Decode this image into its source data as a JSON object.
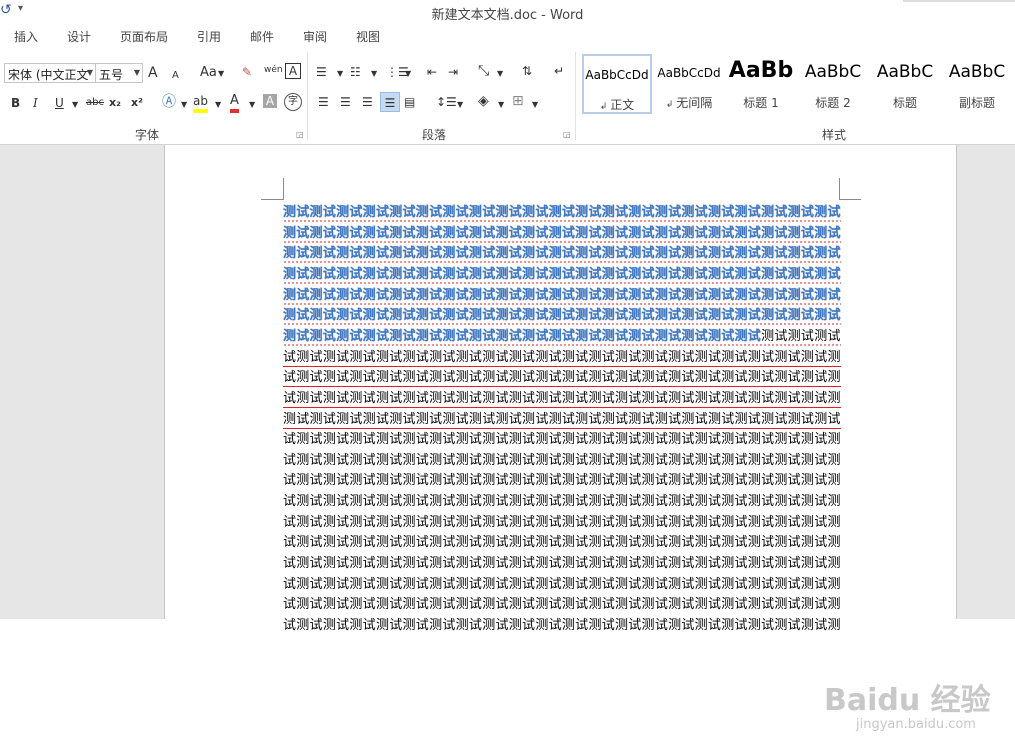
{
  "window": {
    "title": "新建文本文档.doc - Word"
  },
  "tabs": [
    "插入",
    "设计",
    "页面布局",
    "引用",
    "邮件",
    "审阅",
    "视图"
  ],
  "font_group": {
    "font_name": "宋体 (中文正文",
    "font_size": "五号",
    "grow_label": "A",
    "shrink_label": "A",
    "case_label": "Aa",
    "pinyin_label": "wén",
    "border_char_label": "A",
    "bold": "B",
    "italic": "I",
    "underline": "U",
    "strike": "abc",
    "subscript": "x₂",
    "superscript": "x²",
    "label": "字体"
  },
  "para_group": {
    "label": "段落"
  },
  "styles_group": {
    "label": "样式",
    "items": [
      {
        "sample": "AaBbCcDd",
        "name": "正文"
      },
      {
        "sample": "AaBbCcDd",
        "name": "无间隔"
      },
      {
        "sample": "AaBb",
        "name": "标题 1"
      },
      {
        "sample": "AaBbC",
        "name": "标题 2"
      },
      {
        "sample": "AaBbC",
        "name": "标题"
      },
      {
        "sample": "AaBbC",
        "name": "副标题"
      }
    ]
  },
  "document": {
    "highlighted_lines": [
      "测试测试测试测试测试测试测试测试测试测试测试测试测试测试测试测试测试测试测试测试测试测试测试测试测试测试测试测试",
      "测试测试测试测试测试测试测试测试测试测试测试测试测试测试测试测试测试测试测试测试测试测试测试测试测试测试测试测试",
      "测试测试测试测试测试测试测试测试测试测试测试测试测试测试测试测试测试测试测试测试测试测试测试测试测试测试测试测试",
      "测试测试测试测试测试测试测试测试测试测试测试测试测试测试测试测试测试测试测试测试测试测试测试测试测试测试测试测试",
      "测试测试测试测试测试测试测试测试测试测试测试测试测试测试测试测试测试测试测试测试测试测试测试测试测试测试测试测试",
      "测试测试测试测试测试测试测试测试测试测试测试测试测试测试测试测试测试测试测试测试测试测试测试测试测试测试测试测试"
    ],
    "mixed_line": {
      "highlighted": "测试测试测试测试测试测试测试测试测试测试测试测试测试测试测试测试测试测试",
      "plain": "测试测试测试测试测试测试测"
    },
    "plain_lines": [
      "试测试测试测试测试测试测试测试测试测试测试测试测试测试测试测试测试测试测试测试测试测试测试测试测试测试测试测试测",
      "试测试测试测试测试测试测试测试测试测试测试测试测试测试测试测试测试测试测试测试测试测试测试测试测试测试测试测试测",
      "试测试测试测试测试测试测试测试测试测试测试测试测试测试测试测试测试测试测试测试测试测试测试测试测试测试测试测试测",
      "测试测试测试测试测试测试测试测试测试测试测试测试测试测试测试测试测试测试测试测试测试测试测试测试测试测试测试测试",
      "试测试测试测试测试测试测试测试测试测试测试测试测试测试测试测试测试测试测试测试测试测试测试测试测试测试测试测试测",
      "试测试测试测试测试测试测试测试测试测试测试测试测试测试测试测试测试测试测试测试测试测试测试测试测试测试测试测试测",
      "试测试测试测试测试测试测试测试测试测试测试测试测试测试测试测试测试测试测试测试测试测试测试测试测试测试测试测试测",
      "试测试测试测试测试测试测试测试测试测试测试测试测试测试测试测试测试测试测试测试测试测试测试测试测试测试测试测试测",
      "试测试测试测试测试测试测试测试测试测试测试测试测试测试测试测试测试测试测试测试测试测试测试测试测试测试测试测试测",
      "试测试测试测试测试测试测试测试测试测试测试测试测试测试测试测试测试测试测试测试测试测试测试测试测试测试测试测试测",
      "试测试测试测试测试测试测试测试测试测试测试测试测试测试测试测试测试测试测试测试测试测试测试测试测试测试测试测试测",
      "试测试测试测试测试测试测试测试测试测试测试测试测试测试测试测试测试测试测试测试测试测试测试测试测试测试测试测试测",
      "试测试测试测试测试测试测试测试测试测试测试测试测试测试测试测试测试测试测试测试测试测试测试测试测试测试测试测试测",
      "试测试测试测试测试测试测试测试测试测试测试测试测试测试测试测试测试测试测试测试测试测试测试测试测试测试测试测试测"
    ]
  },
  "watermark": {
    "site": "Baidu 经验",
    "url": "jingyan.baidu.com"
  },
  "colors": {
    "highlight_text": "#3d77c6",
    "squiggle": "#e02020",
    "word_blue": "#2b579a"
  }
}
